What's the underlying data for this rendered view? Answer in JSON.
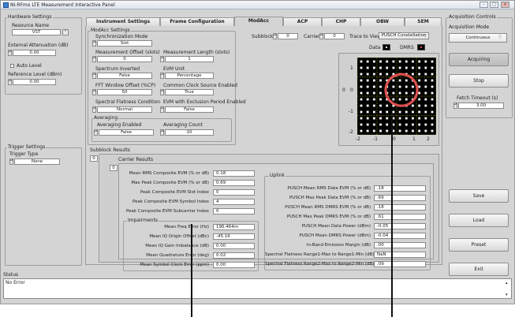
{
  "window": {
    "title": "NI-RFmx LTE Measurement Interactive Panel"
  },
  "hardware": {
    "group_label": "Hardware Settings",
    "resource_name_label": "Resource Name",
    "resource_name": "VST",
    "ext_atten_label": "External Attenuation (dB)",
    "ext_atten": "0.00",
    "auto_level_label": "Auto Level",
    "ref_level_label": "Reference Level (dBm)",
    "ref_level": "0.00"
  },
  "trigger": {
    "group_label": "Trigger Settings",
    "type_label": "Trigger Type",
    "type": "None"
  },
  "status": {
    "label": "Status",
    "text": "No Error"
  },
  "tabs": [
    "Instrument Settings",
    "Frame Configuration",
    "ModAcc",
    "ACP",
    "CHP",
    "OBW",
    "SEM"
  ],
  "modacc_settings": {
    "group_label": "ModAcc Settings",
    "sync_mode_label": "Synchronization Mode",
    "sync_mode": "Slot",
    "meas_offset_label": "Measurement Offset (slots)",
    "meas_offset": "0",
    "meas_length_label": "Measurement Length (slots)",
    "meas_length": "1",
    "spectrum_inverted_label": "Spectrum Inverted",
    "spectrum_inverted": "False",
    "evm_unit_label": "EVM Unit",
    "evm_unit": "Percentage",
    "fft_window_label": "FFT Window Offset (%CP)",
    "fft_window": "50",
    "common_clock_label": "Common Clock Source Enabled",
    "common_clock": "True",
    "spectral_flatness_label": "Spectral Flatness Condition",
    "spectral_flatness": "Normal",
    "evm_excl_label": "EVM with Exclusion Period Enabled",
    "evm_excl": "False",
    "averaging_label": "Averaging",
    "avg_enabled_label": "Averaging Enabled",
    "avg_enabled": "False",
    "avg_count_label": "Averaging Count",
    "avg_count": "10"
  },
  "trace": {
    "subblock_label": "Subblock",
    "subblock": "0",
    "carrier_label": "Carrier",
    "carrier": "0",
    "trace_to_view_label": "Trace to View",
    "trace_to_view": "PUSCH Constellation",
    "legend_data": "Data",
    "legend_dmrs": "DMRS",
    "ticks_x": [
      "-2",
      "-1",
      "0",
      "1",
      "2"
    ],
    "ticks_y": [
      "1",
      "0",
      "-1",
      "-2"
    ]
  },
  "results": {
    "subblock_results_label": "Subblock Results",
    "subblock_index": "0",
    "carrier_results_label": "Carrier Results",
    "carrier_index": "0",
    "carrier_rows": [
      {
        "label": "Mean RMS Composite EVM (% or dB)",
        "value": "0.18"
      },
      {
        "label": "Max Peak Composite EVM (% or dB)",
        "value": "0.69"
      },
      {
        "label": "Peak Composite EVM Slot Index",
        "value": "0"
      },
      {
        "label": "Peak Composite EVM Symbol Index",
        "value": "4"
      },
      {
        "label": "Peak Composite EVM Subcarrier Index",
        "value": "0"
      }
    ],
    "impairments_label": "Impairments",
    "impairment_rows": [
      {
        "label": "Mean Freq Error (Hz)",
        "value": "196.464m"
      },
      {
        "label": "Mean IQ Origin Offset (dBc)",
        "value": "-45.16"
      },
      {
        "label": "Mean IQ Gain Imbalance (dB)",
        "value": "0.00"
      },
      {
        "label": "Mean Quadrature Error (deg)",
        "value": "0.02"
      },
      {
        "label": "Mean Symbol Clock Error (ppm)",
        "value": "0.00"
      }
    ],
    "uplink_label": "Uplink",
    "uplink_rows": [
      {
        "label": "PUSCH Mean RMS Data EVM (% or dB)",
        "value": ".18"
      },
      {
        "label": "PUSCH Max Peak Data EVM (% or dB)",
        "value": ".69"
      },
      {
        "label": "PUSCH Mean RMS DMRS EVM (% or dB)",
        "value": ".18"
      },
      {
        "label": "PUSCH Max Peak DMRS EVM (% or dB)",
        "value": ".61"
      },
      {
        "label": "PUSCH Mean Data Power (dBm)",
        "value": "-0.05"
      },
      {
        "label": "PUSCH Mean DMRS Power (dBm)",
        "value": "-0.04"
      },
      {
        "label": "In-Band Emission Margin (dB)",
        "value": ".00"
      },
      {
        "label": "Spectral Flatness Range1-Max to Range1-Min (dB)",
        "value": "NaN"
      },
      {
        "label": "Spectral Flatness Range2-Max to Range2-Min (dB)",
        "value": ".09"
      }
    ]
  },
  "acquisition": {
    "group_label": "Acquisition Controls",
    "mode_label": "Acquisition Mode",
    "mode": "Continuous",
    "acquiring_label": "Acquiring",
    "stop_label": "Stop",
    "fetch_timeout_label": "Fetch Timeout (s)",
    "fetch_timeout": "3.00"
  },
  "actions": {
    "save": "Save",
    "load": "Load",
    "preset": "Preset",
    "exit": "Exit"
  },
  "colors": {
    "data_symbol": "#ffffff",
    "dmrs_symbol": "#e05050",
    "graph_bg": "#000000",
    "graph_grid": "#c8c800"
  }
}
